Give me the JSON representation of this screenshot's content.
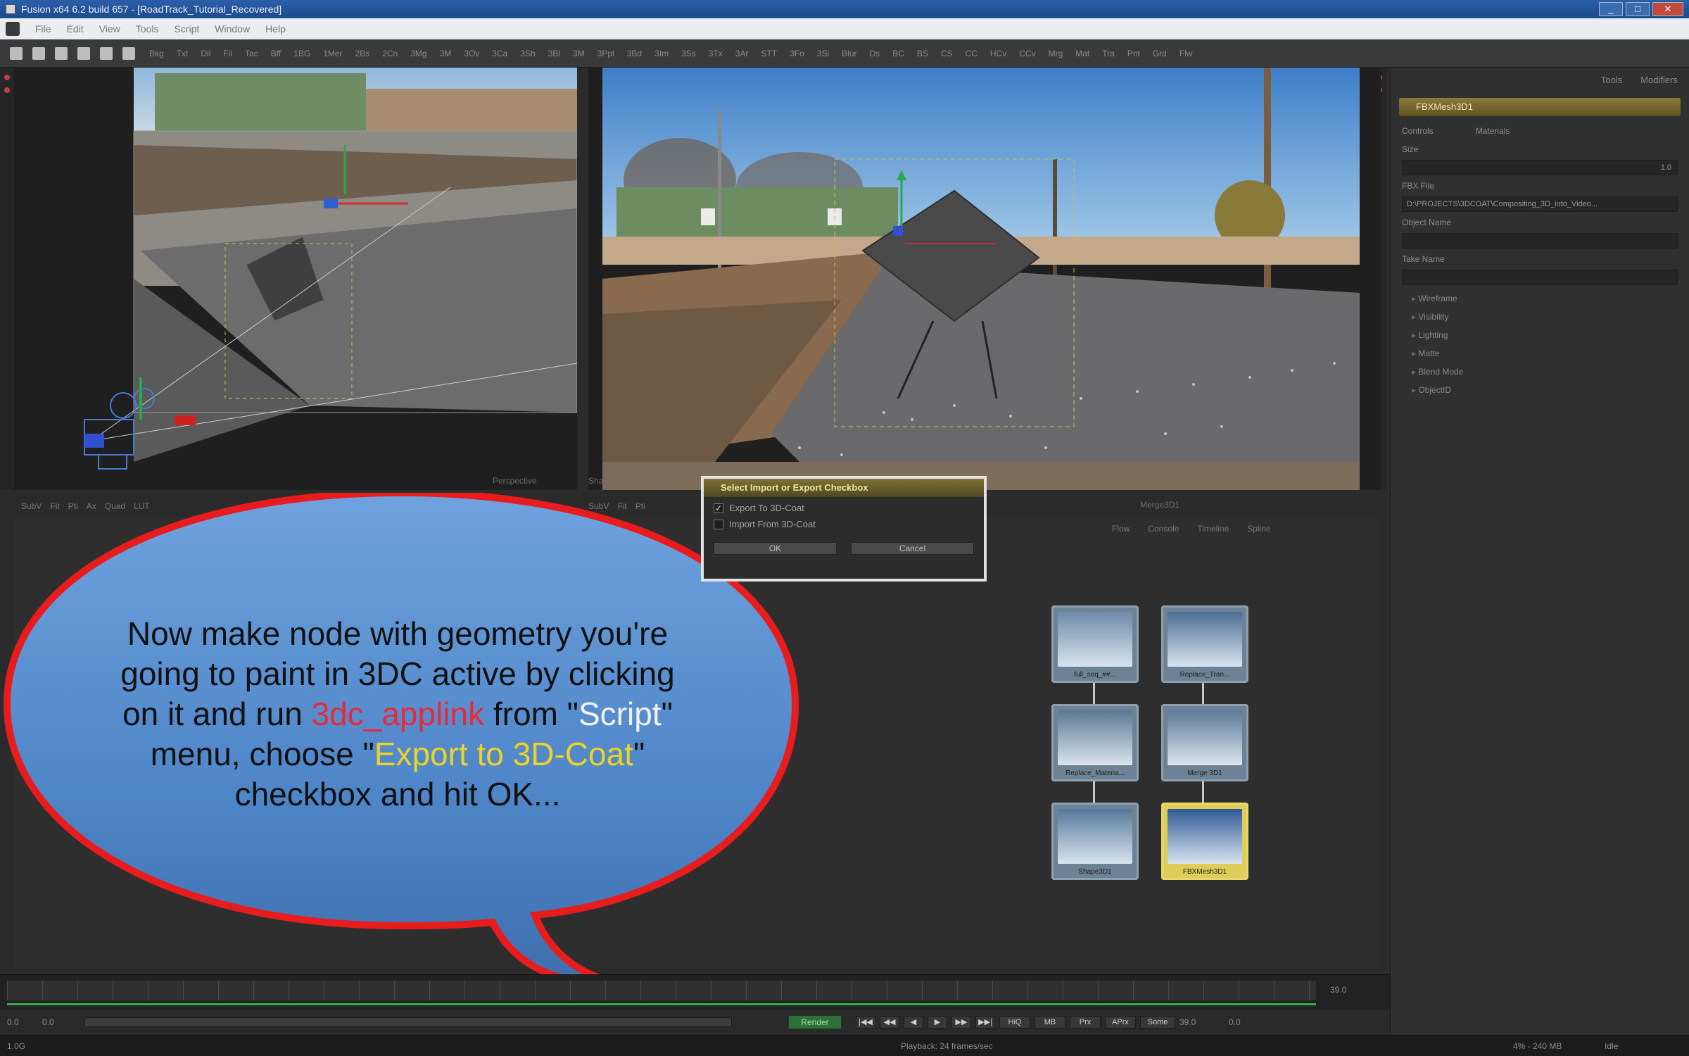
{
  "window": {
    "title": "Fusion x64 6.2 build 657 - [RoadTrack_Tutorial_Recovered]",
    "controls": [
      "_",
      "□",
      "✕"
    ]
  },
  "menu": [
    "File",
    "Edit",
    "View",
    "Tools",
    "Script",
    "Window",
    "Help"
  ],
  "toolbar": {
    "tools": [
      "Bkg",
      "Txt",
      "Dil",
      "Fil",
      "Tac",
      "Bff",
      "1BG",
      "1Mer",
      "2Bs",
      "2Cn",
      "3Mg",
      "3M",
      "3Ov",
      "3Ca",
      "3Sh",
      "3Bl",
      "3M",
      "3Ppl",
      "3Bd",
      "3Im",
      "3Ss",
      "3Tx",
      "3Ar",
      "STT",
      "3Fo",
      "3Si",
      "Blur",
      "Ds",
      "BC",
      "BS",
      "CS",
      "CC",
      "HCv",
      "CCv",
      "Mrg",
      "Mat",
      "Tra",
      "Pnt",
      "Grd",
      "Flw"
    ]
  },
  "left_viewer": {
    "label": "Perspective",
    "controls": [
      "SubV",
      "Fit",
      "Pti",
      "Ax",
      "Quad",
      "LUT"
    ]
  },
  "right_viewer": {
    "label": "Shadow_Camera",
    "bottom_label": "Merge3D1",
    "controls": [
      "SubV",
      "Fit",
      "Pti"
    ]
  },
  "inspector": {
    "tabs": [
      "Tools",
      "Modifiers"
    ],
    "node_title": "FBXMesh3D1",
    "mode_tabs": [
      "Controls",
      "Materials"
    ],
    "size_label": "Size",
    "size_value": "1.0",
    "fbx_file_label": "FBX File",
    "fbx_file_value": "D:\\PROJECTS\\3DCOAT\\Compositing_3D_into_Video...",
    "object_name_label": "Object Name",
    "take_name_label": "Take Name",
    "tree": [
      "Wireframe",
      "Visibility",
      "Lighting",
      "Matte",
      "Blend Mode",
      "ObjectID"
    ]
  },
  "flow": {
    "tabs": [
      "Flow",
      "Console",
      "Timeline",
      "Spline"
    ],
    "nodes": [
      {
        "name": "full_seq_##...",
        "color": "#6d8aa8"
      },
      {
        "name": "Replace_Tran...",
        "color": "#4b6c94"
      },
      {
        "name": "Replace_Materia...",
        "color": "#5d7894"
      },
      {
        "name": "Merge 3D1",
        "color": "#5e7a98"
      },
      {
        "name": "Shape3D1",
        "color": "#56789a"
      },
      {
        "name": "FBXMesh3D1",
        "color": "#2f5a96"
      }
    ]
  },
  "dialog": {
    "title": "Select Import or Export Checkbox",
    "options": [
      {
        "label": "Export To 3D-Coat",
        "checked": true
      },
      {
        "label": "Import From 3D-Coat",
        "checked": false
      }
    ],
    "ok_label": "OK",
    "cancel_label": "Cancel"
  },
  "callout": {
    "line1": "Now make node with geometry you're",
    "line2": "going to paint in 3DC active by clicking",
    "line3_prefix": "on it and run ",
    "line3_highlight": "3dc_applink",
    "line3_mid": " from \"",
    "line3_script": "Script",
    "line3_end": "\"",
    "line4_prefix": "menu, choose \"",
    "line4_highlight": "Export to 3D-Coat",
    "line4_end": "\"",
    "line5": "checkbox and hit OK...",
    "fill_color": "#5a8fd0",
    "border_color": "#e81c1c"
  },
  "timeline": {
    "start": "0.0",
    "end": "0.0",
    "render_start": "0.0",
    "render_end": "39.0",
    "current": "39.0",
    "render_label": "Render",
    "buttons": [
      "|◀◀",
      "◀◀",
      "◀",
      "▶",
      "▶▶",
      "▶▶|"
    ],
    "toggles": [
      "HiQ",
      "MB",
      "Prx",
      "APrx",
      "Some"
    ],
    "playback": "Playback: 24 frames/sec"
  },
  "status": {
    "left": "1.0G",
    "right_percent": "4% - 240 MB",
    "state": "Idle"
  }
}
